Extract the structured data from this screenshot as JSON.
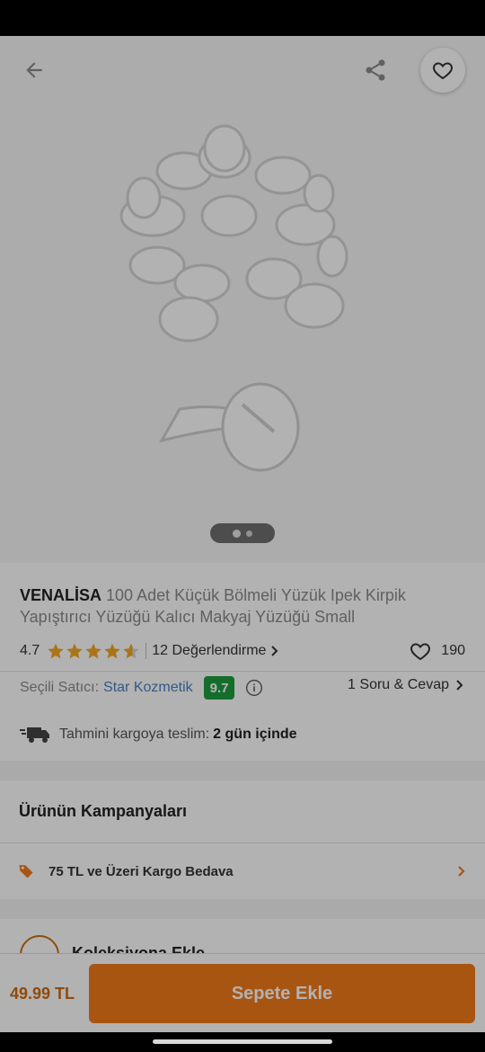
{
  "product": {
    "brand": "VENALİSA",
    "title": "100 Adet Küçük Bölmeli Yüzük Ipek Kirpik Yapıştırıcı Yüzüğü Kalıcı Makyaj Yüzüğü Small",
    "rating": "4.7",
    "rating_value": 4.7,
    "reviews_label": "12 Değerlendirme",
    "favorite_count": "190",
    "image_count": 2,
    "active_image": 1
  },
  "seller": {
    "label": "Seçili Satıcı:",
    "name": "Star Kozmetik",
    "score": "9.7",
    "score_color": "#1f9d3f",
    "qa_label": "1 Soru & Cevap"
  },
  "shipping": {
    "label": "Tahmini kargoya teslim:",
    "value": "2 gün içinde"
  },
  "campaigns": {
    "title": "Ürünün Kampanyaları",
    "items": [
      {
        "text": "75 TL ve Üzeri Kargo Bedava",
        "icon": "tag-icon"
      }
    ]
  },
  "collection": {
    "label": "Koleksiyona Ekle"
  },
  "purchase": {
    "price": "49.99 TL",
    "button_label": "Sepete Ekle"
  },
  "colors": {
    "accent": "#f27a1a",
    "link": "#4a7fc1",
    "star": "#f5a623"
  },
  "icons": {
    "back": "arrow-left-icon",
    "share": "share-icon",
    "favorite": "heart-icon"
  }
}
